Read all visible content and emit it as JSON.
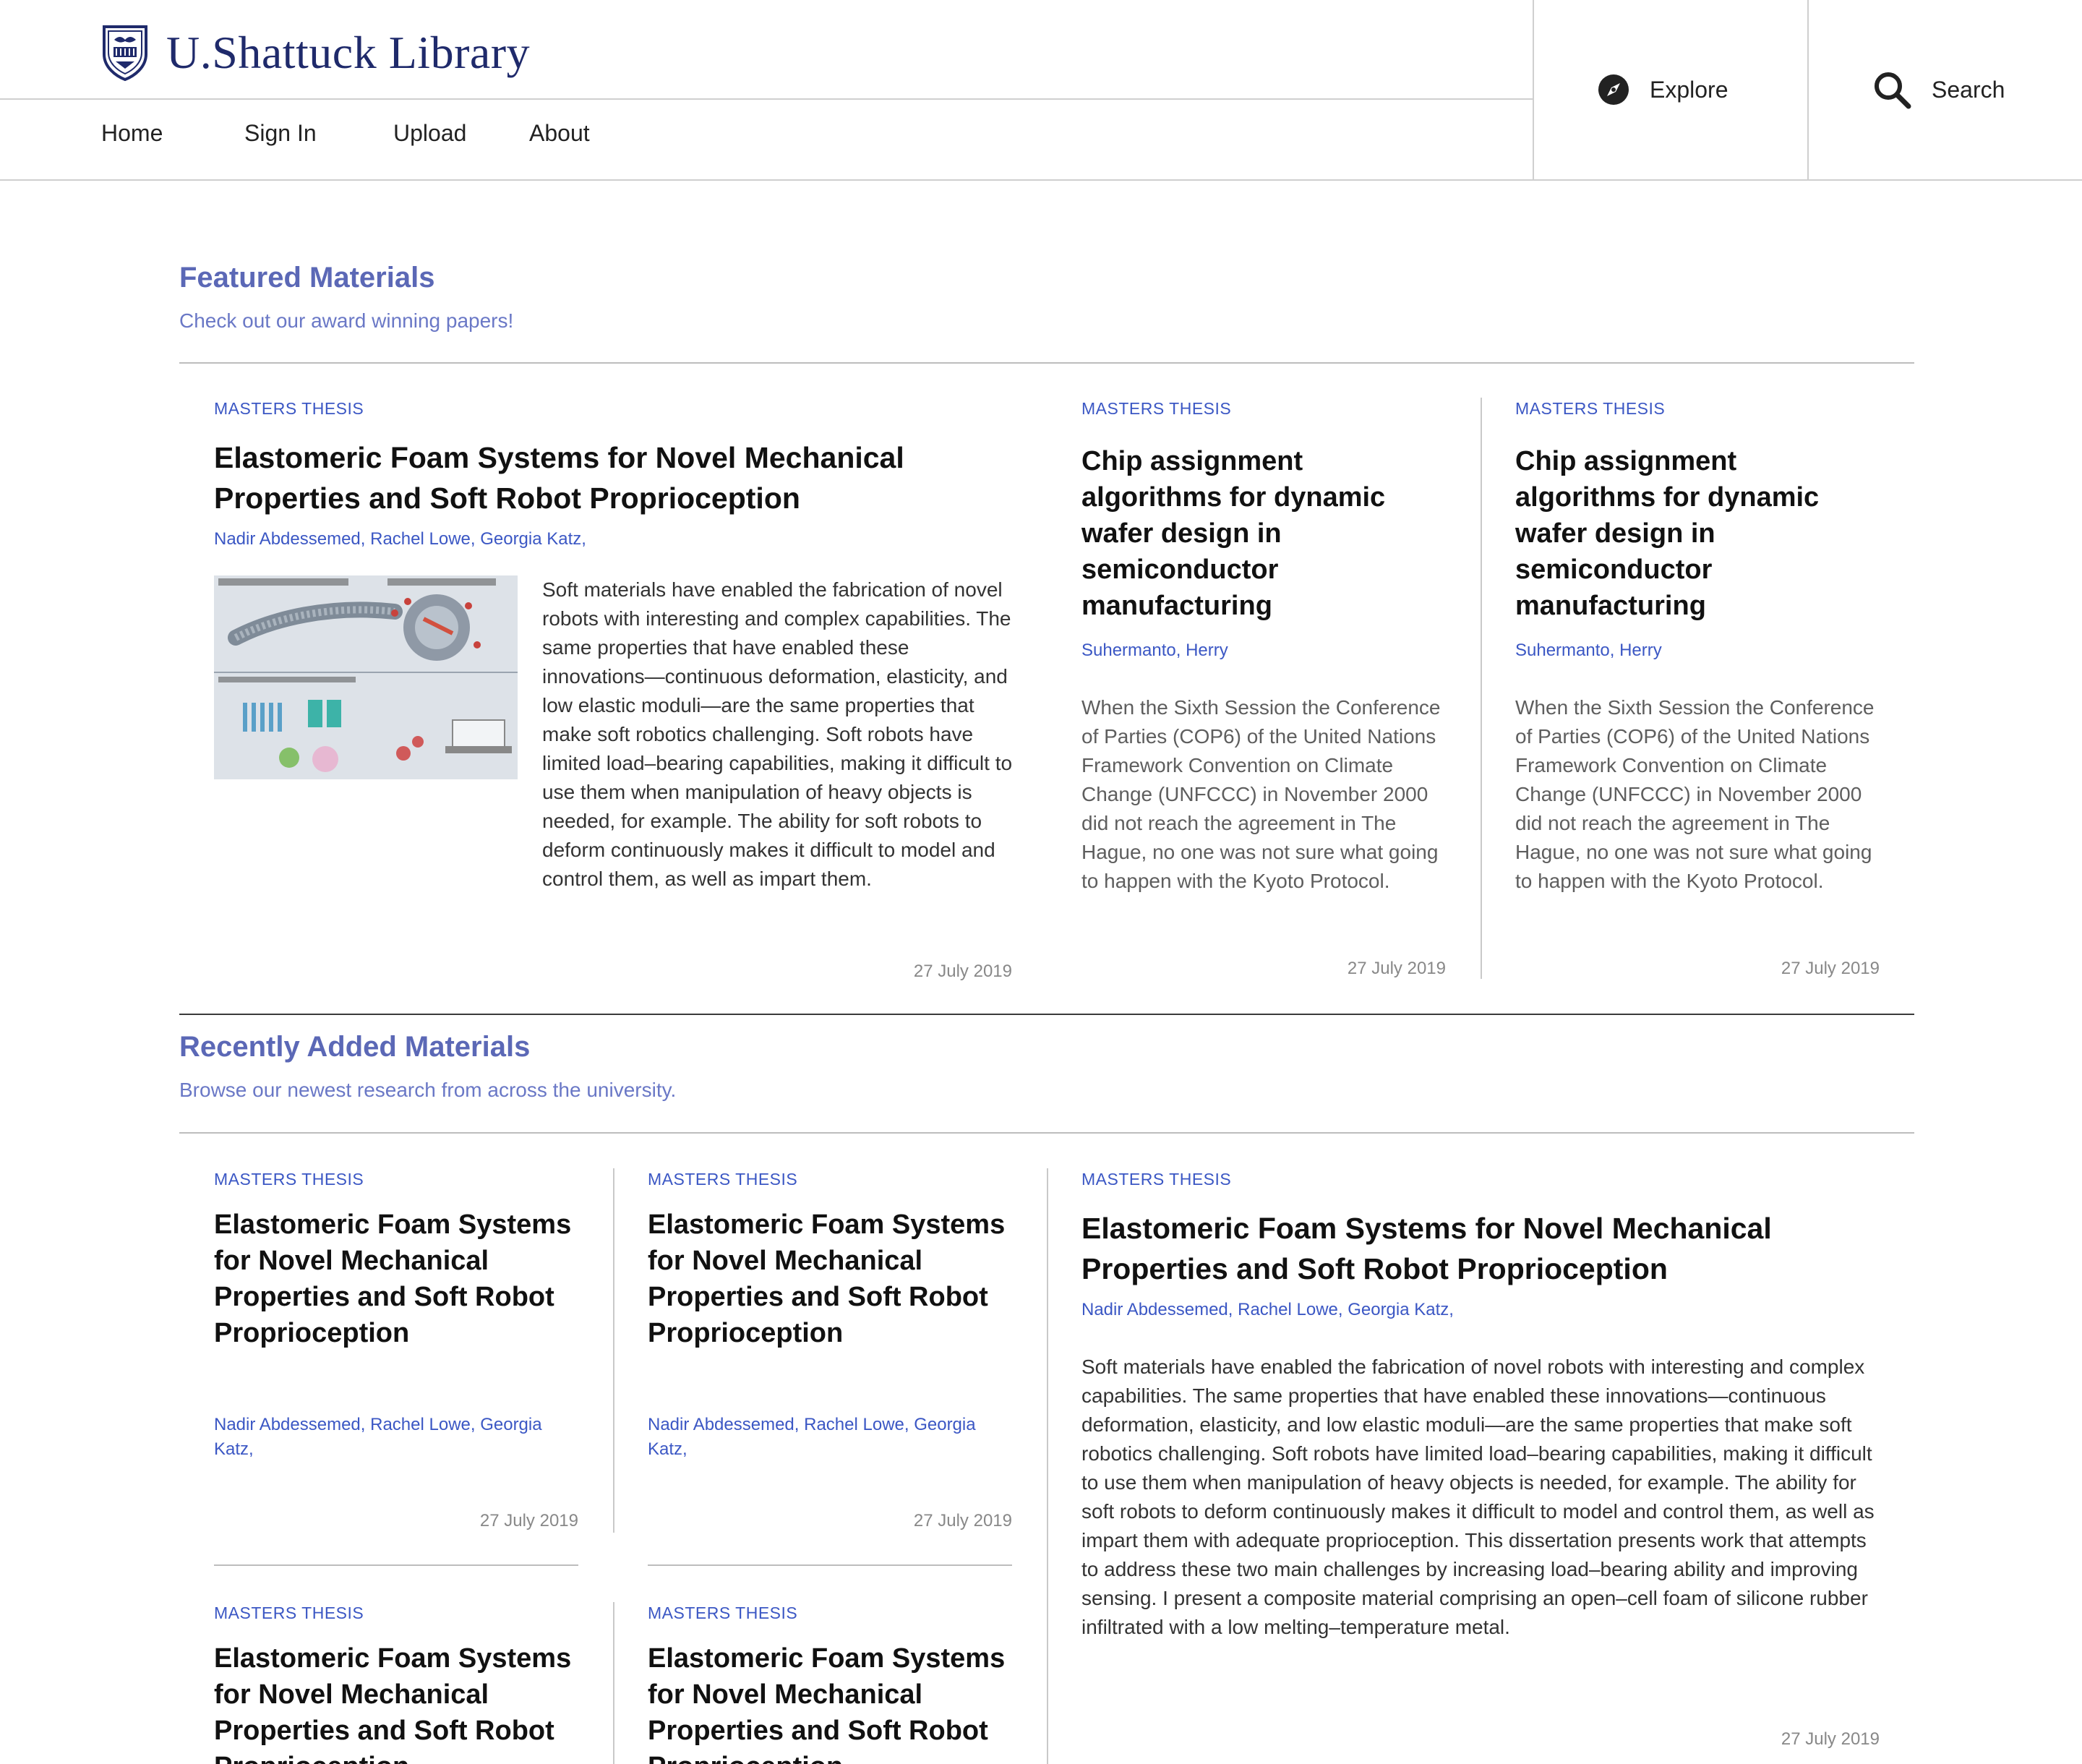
{
  "brand": {
    "name": "U.Shattuck Library"
  },
  "nav": {
    "home": "Home",
    "sign_in": "Sign In",
    "upload": "Upload",
    "about": "About"
  },
  "header_actions": {
    "explore": "Explore",
    "search": "Search"
  },
  "featured": {
    "title": "Featured Materials",
    "subtitle": "Check out our award winning papers!",
    "main": {
      "type": "MASTERS THESIS",
      "title": "Elastomeric Foam Systems for Novel Mechanical Properties and Soft Robot Proprioception",
      "authors": "Nadir Abdessemed, Rachel Lowe, Georgia Katz,",
      "description": "Soft materials have enabled the fabrication of novel robots with interesting and complex capabilities. The same properties that have enabled these innovations—continuous deformation, elasticity, and low elastic moduli—are the same properties that make soft robotics challenging. Soft robots have limited load–bearing capabilities, making it difficult to use them when manipulation of heavy objects is needed, for example. The ability for soft robots to deform continuously makes it difficult to model and control them, as well as impart them.",
      "date": "27 July 2019"
    },
    "side": [
      {
        "type": "MASTERS THESIS",
        "title": "Chip assignment algorithms for dynamic wafer design in semiconductor manufacturing",
        "authors": "Suhermanto, Herry",
        "description": "When the Sixth Session the Conference of Parties (COP6) of the United Nations Framework Convention on Climate Change (UNFCCC) in November 2000 did not reach the agreement in The Hague, no one was not sure what going to happen with the Kyoto Protocol.",
        "date": "27 July 2019"
      },
      {
        "type": "MASTERS THESIS",
        "title": "Chip assignment algorithms for dynamic wafer design in semiconductor manufacturing",
        "authors": "Suhermanto, Herry",
        "description": "When the Sixth Session the Conference of Parties (COP6) of the United Nations Framework Convention on Climate Change (UNFCCC) in November 2000 did not reach the agreement in The Hague, no one was not sure what going to happen with the Kyoto Protocol.",
        "date": "27 July 2019"
      }
    ]
  },
  "recent": {
    "title": "Recently Added Materials",
    "subtitle": "Browse our newest research from across the university.",
    "grid": [
      {
        "type": "MASTERS THESIS",
        "title": "Elastomeric Foam Systems for Novel Mechanical Properties and Soft Robot Proprioception",
        "authors": "Nadir Abdessemed, Rachel Lowe, Georgia Katz,",
        "date": "27 July 2019"
      },
      {
        "type": "MASTERS THESIS",
        "title": "Elastomeric Foam Systems for Novel Mechanical Properties and Soft Robot Proprioception",
        "authors": "Nadir Abdessemed, Rachel Lowe, Georgia Katz,",
        "date": "27 July 2019"
      },
      {
        "type": "MASTERS THESIS",
        "title": "Elastomeric Foam Systems for Novel Mechanical Properties and Soft Robot Proprioception"
      },
      {
        "type": "MASTERS THESIS",
        "title": "Elastomeric Foam Systems for Novel Mechanical Properties and Soft Robot Proprioception"
      }
    ],
    "large": {
      "type": "MASTERS THESIS",
      "title": "Elastomeric Foam Systems for Novel Mechanical Properties and Soft Robot Proprioception",
      "authors": "Nadir Abdessemed, Rachel Lowe, Georgia Katz,",
      "description": "Soft materials have enabled the fabrication of novel robots with interesting and complex capabilities. The same properties that have enabled these innovations—continuous deformation, elasticity, and low elastic moduli—are the same properties that make soft robotics challenging. Soft robots have limited load–bearing capabilities, making it difficult to use them when manipulation of heavy objects is needed, for example. The ability for soft robots to deform continuously makes it difficult to model and control them, as well as impart them with adequate proprioception. This dissertation presents work that attempts to address these two main challenges by increasing load–bearing ability and improving sensing. I present a composite material comprising an open–cell foam of silicone rubber infiltrated with a low melting–temperature metal.",
      "date": "27 July 2019"
    }
  },
  "icons": {
    "logo": "university-shield-icon",
    "explore": "compass-icon",
    "search": "search-icon"
  },
  "colors": {
    "brand": "#1f2a6b",
    "accent": "#3b57c4",
    "section_title": "#5b68b6"
  }
}
